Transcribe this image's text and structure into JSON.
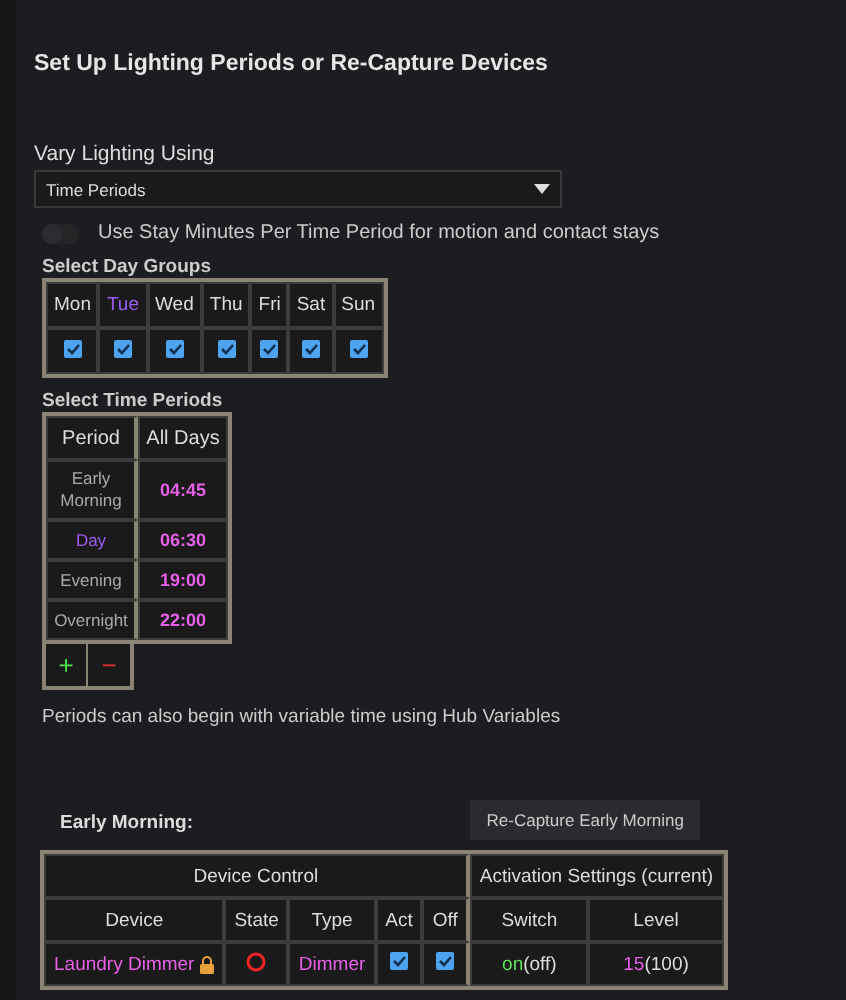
{
  "title": "Set Up Lighting Periods or Re-Capture Devices",
  "vary": {
    "label": "Vary Lighting Using",
    "value": "Time Periods"
  },
  "stay_toggle": {
    "label": "Use Stay Minutes Per Time Period for motion and contact stays",
    "on": false
  },
  "day_groups": {
    "label": "Select Day Groups",
    "days": [
      {
        "label": "Mon",
        "selected": false,
        "checked": true
      },
      {
        "label": "Tue",
        "selected": true,
        "checked": true
      },
      {
        "label": "Wed",
        "selected": false,
        "checked": true
      },
      {
        "label": "Thu",
        "selected": false,
        "checked": true
      },
      {
        "label": "Fri",
        "selected": false,
        "checked": true
      },
      {
        "label": "Sat",
        "selected": false,
        "checked": true
      },
      {
        "label": "Sun",
        "selected": false,
        "checked": true
      }
    ]
  },
  "time_periods": {
    "label": "Select Time Periods",
    "columns": [
      "Period",
      "All Days"
    ],
    "rows": [
      {
        "period": "Early Morning",
        "time": "04:45",
        "selected": false
      },
      {
        "period": "Day",
        "time": "06:30",
        "selected": true
      },
      {
        "period": "Evening",
        "time": "19:00",
        "selected": false
      },
      {
        "period": "Overnight",
        "time": "22:00",
        "selected": false
      }
    ],
    "add": "+",
    "remove": "−"
  },
  "note": "Periods can also begin with variable time using Hub Variables",
  "period_section": {
    "title": "Early Morning:",
    "recapture_button": "Re-Capture Early Morning",
    "groups": [
      "Device Control",
      "Activation Settings (current)"
    ],
    "columns": [
      "Device",
      "State",
      "Type",
      "Act",
      "Off",
      "Switch",
      "Level"
    ],
    "rows": [
      {
        "device": "Laundry Dimmer",
        "locked": true,
        "state_on": false,
        "type": "Dimmer",
        "act": true,
        "off": true,
        "switch": "on",
        "switch_current": "(off)",
        "level": "15",
        "level_current": "(100)"
      }
    ]
  }
}
